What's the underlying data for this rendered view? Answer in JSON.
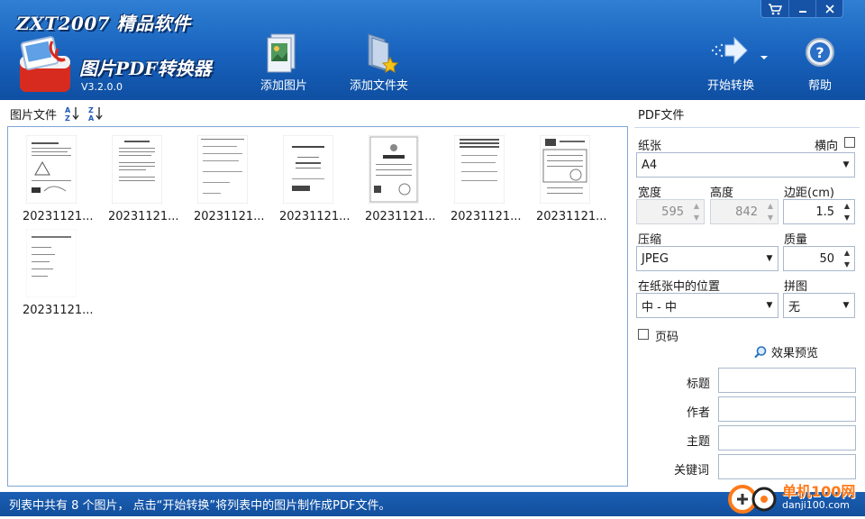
{
  "header": {
    "brand": "ZXT2007 精品软件",
    "app_title": "图片PDF转换器",
    "version": "V3.2.0.0",
    "toolbar": {
      "add_image": "添加图片",
      "add_folder": "添加文件夹",
      "start": "开始转换",
      "help": "帮助"
    }
  },
  "left": {
    "label": "图片文件",
    "files": [
      {
        "name": "20231121..."
      },
      {
        "name": "20231121..."
      },
      {
        "name": "20231121..."
      },
      {
        "name": "20231121..."
      },
      {
        "name": "20231121..."
      },
      {
        "name": "20231121..."
      },
      {
        "name": "20231121..."
      },
      {
        "name": "20231121..."
      }
    ]
  },
  "pdf": {
    "section_title": "PDF文件",
    "paper_label": "纸张",
    "landscape_label": "横向",
    "landscape_checked": false,
    "paper_value": "A4",
    "width_label": "宽度",
    "width_value": "595",
    "height_label": "高度",
    "height_value": "842",
    "margin_label": "边距(cm)",
    "margin_value": "1.5",
    "compress_label": "压缩",
    "compress_value": "JPEG",
    "quality_label": "质量",
    "quality_value": "50",
    "position_label": "在纸张中的位置",
    "position_value": "中 - 中",
    "tile_label": "拼图",
    "tile_value": "无",
    "page_number_label": "页码",
    "page_number_checked": false,
    "preview_label": "效果预览",
    "meta_title_label": "标题",
    "meta_title_value": "",
    "meta_author_label": "作者",
    "meta_author_value": "",
    "meta_subject_label": "主题",
    "meta_subject_value": "",
    "meta_keywords_label": "关键词",
    "meta_keywords_value": ""
  },
  "status": {
    "text": "列表中共有 8 个图片， 点击“开始转换”将列表中的图片制作成PDF文件。"
  },
  "watermark": {
    "text": "单机100网",
    "url": "danji100.com"
  },
  "colors": {
    "header_blue": "#1862bd",
    "status_blue": "#124f9c",
    "accent_orange": "#ff7a1a"
  }
}
